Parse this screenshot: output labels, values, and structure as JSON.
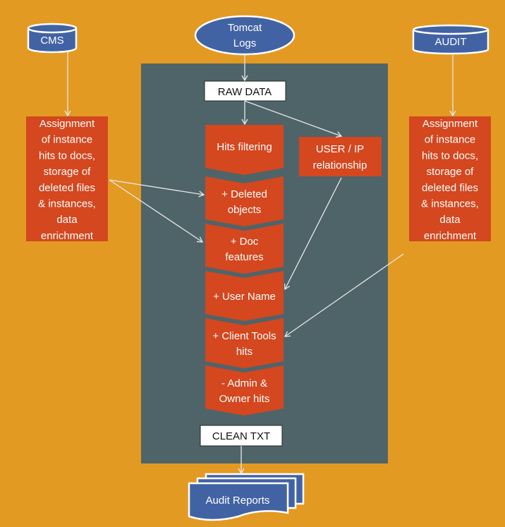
{
  "colors": {
    "background": "#E39A22",
    "panel": "#4F6469",
    "process": "#D4471F",
    "source": "#4263A3",
    "box": "#FFFFFF"
  },
  "sources": {
    "cms": "CMS",
    "tomcat": [
      "Tomcat",
      "Logs"
    ],
    "audit": "AUDIT"
  },
  "raw_data": "RAW DATA",
  "clean_txt": "CLEAN TXT",
  "user_ip": [
    "USER / IP",
    "relationship"
  ],
  "side_box_left": [
    "Assignment",
    "of instance",
    "hits to docs,",
    "storage of",
    "deleted files",
    "& instances,",
    "data",
    "enrichment"
  ],
  "side_box_right": [
    "Assignment",
    "of instance",
    "hits to docs,",
    "storage of",
    "deleted files",
    "& instances,",
    "data",
    "enrichment"
  ],
  "steps": [
    {
      "lines": [
        "Hits filtering"
      ]
    },
    {
      "lines": [
        "+ Deleted",
        "objects"
      ]
    },
    {
      "lines": [
        "+ Doc",
        "features"
      ]
    },
    {
      "lines": [
        "+ User Name"
      ]
    },
    {
      "lines": [
        "+ Client Tools",
        "hits"
      ]
    },
    {
      "lines": [
        "- Admin &",
        "Owner hits"
      ]
    }
  ],
  "output": "Audit Reports"
}
